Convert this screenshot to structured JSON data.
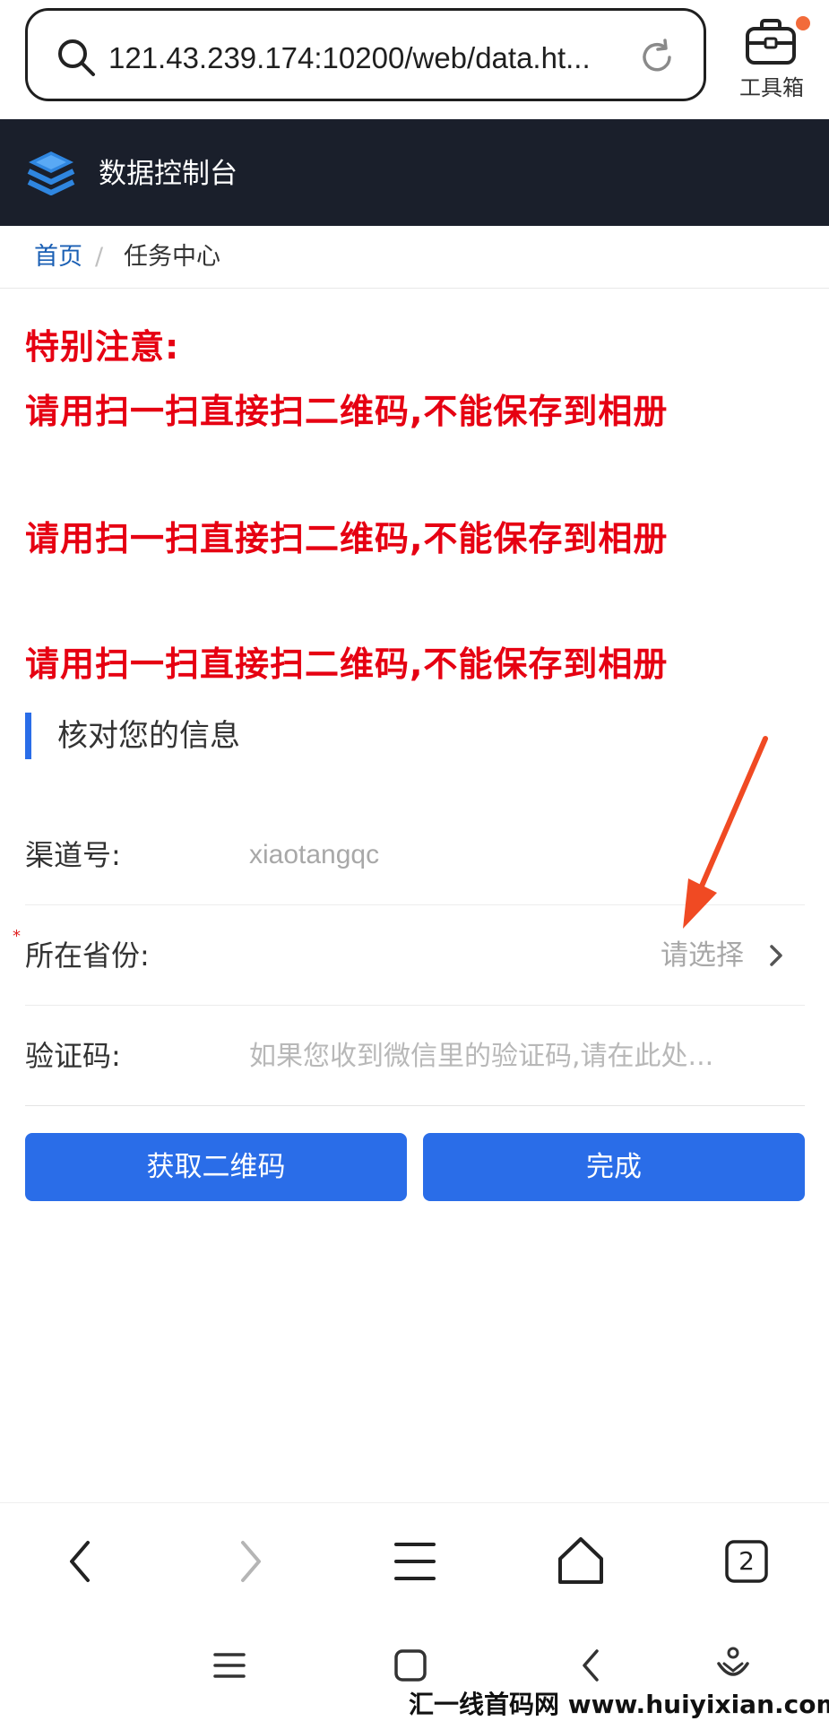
{
  "browser": {
    "url": "121.43.239.174:10200/web/data.ht...",
    "toolbox_label": "工具箱"
  },
  "header": {
    "title": "数据控制台",
    "bg_color": "#1a1f2b"
  },
  "breadcrumb": {
    "home": "首页",
    "separator": "/",
    "current": "任务中心"
  },
  "notice": {
    "title": "特别注意:",
    "lines": [
      "请用扫一扫直接扫二维码,不能保存到相册",
      "请用扫一扫直接扫二维码,不能保存到相册",
      "请用扫一扫直接扫二维码,不能保存到相册"
    ],
    "color": "#e60012"
  },
  "section": {
    "title": "核对您的信息"
  },
  "form": {
    "channel_label": "渠道号:",
    "channel_value": "xiaotangqc",
    "required_mark": "*",
    "province_label": "所在省份:",
    "province_placeholder": "请选择",
    "code_label": "验证码:",
    "code_placeholder": "如果您收到微信里的验证码,请在此处..."
  },
  "buttons": {
    "get_qr": "获取二维码",
    "done": "完成"
  },
  "nav": {
    "tab_count": "2"
  },
  "watermark": "汇一线首码网 www.huiyixian.com",
  "colors": {
    "accent": "#2a6de8",
    "breadcrumb_link": "#1a5fb4",
    "badge": "#f26b3a",
    "arrow": "#f04a23"
  }
}
